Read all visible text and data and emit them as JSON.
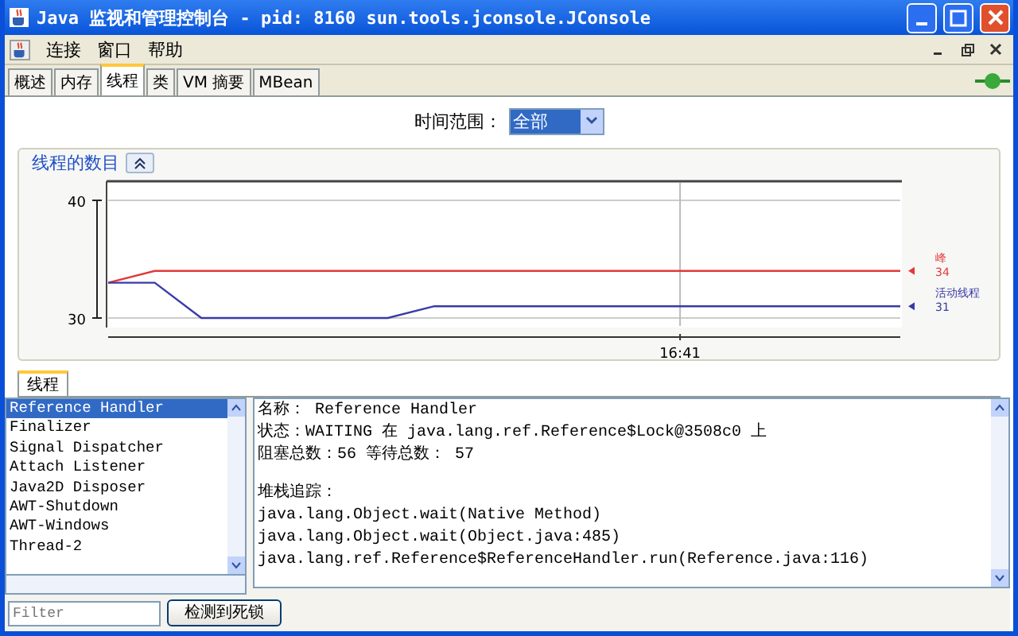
{
  "window": {
    "title": "Java 监视和管理控制台 - pid: 8160 sun.tools.jconsole.JConsole"
  },
  "menu": [
    "连接",
    "窗口",
    "帮助"
  ],
  "tabs": [
    {
      "label": "概述",
      "selected": false
    },
    {
      "label": "内存",
      "selected": false
    },
    {
      "label": "线程",
      "selected": true
    },
    {
      "label": "类",
      "selected": false
    },
    {
      "label": "VM 摘要",
      "selected": false
    },
    {
      "label": "MBean",
      "selected": false
    }
  ],
  "time_range": {
    "label": "时间范围：",
    "value": "全部"
  },
  "threads_chart": {
    "title": "线程的数目",
    "readings": [
      "34",
      "31"
    ],
    "chart_data": {
      "type": "line",
      "ylim": [
        30,
        40
      ],
      "yticks": [
        {
          "value": 30,
          "label": "30"
        },
        {
          "value": 40,
          "label": "40"
        }
      ],
      "annotations": [
        "16:41"
      ],
      "series": [
        {
          "name": "峰",
          "color": "#e03a3a",
          "values": [
            33,
            34,
            34,
            34,
            34,
            34,
            34,
            34,
            34,
            34,
            34,
            34,
            34,
            34,
            34,
            34,
            34,
            34
          ]
        },
        {
          "name": "活动线程",
          "color": "#3a3aa8",
          "values": [
            33,
            33,
            30,
            30,
            30,
            30,
            30,
            31,
            31,
            31,
            31,
            31,
            31,
            31,
            31,
            31,
            31,
            31
          ]
        }
      ]
    }
  },
  "bottom_tabs": [
    {
      "label": "线程",
      "selected": true
    }
  ],
  "thread_list": [
    {
      "name": "Reference Handler",
      "selected": true
    },
    {
      "name": "Finalizer",
      "selected": false
    },
    {
      "name": "Signal Dispatcher",
      "selected": false
    },
    {
      "name": "Attach Listener",
      "selected": false
    },
    {
      "name": "Java2D Disposer",
      "selected": false
    },
    {
      "name": "AWT-Shutdown",
      "selected": false
    },
    {
      "name": "AWT-Windows",
      "selected": false
    },
    {
      "name": "Thread-2",
      "selected": false
    }
  ],
  "details": {
    "info": [
      "名称：  Reference Handler",
      "状态：WAITING 在 java.lang.ref.Reference$Lock@3508c0 上",
      "阻塞总数：56   等待总数：  57"
    ],
    "stack_title": "堆栈追踪：",
    "stack": [
      "java.lang.Object.wait(Native Method)",
      "java.lang.Object.wait(Object.java:485)",
      "java.lang.ref.Reference$ReferenceHandler.run(Reference.java:116)"
    ]
  },
  "filter": {
    "placeholder": "Filter"
  },
  "deadlock_button": "检测到死锁"
}
